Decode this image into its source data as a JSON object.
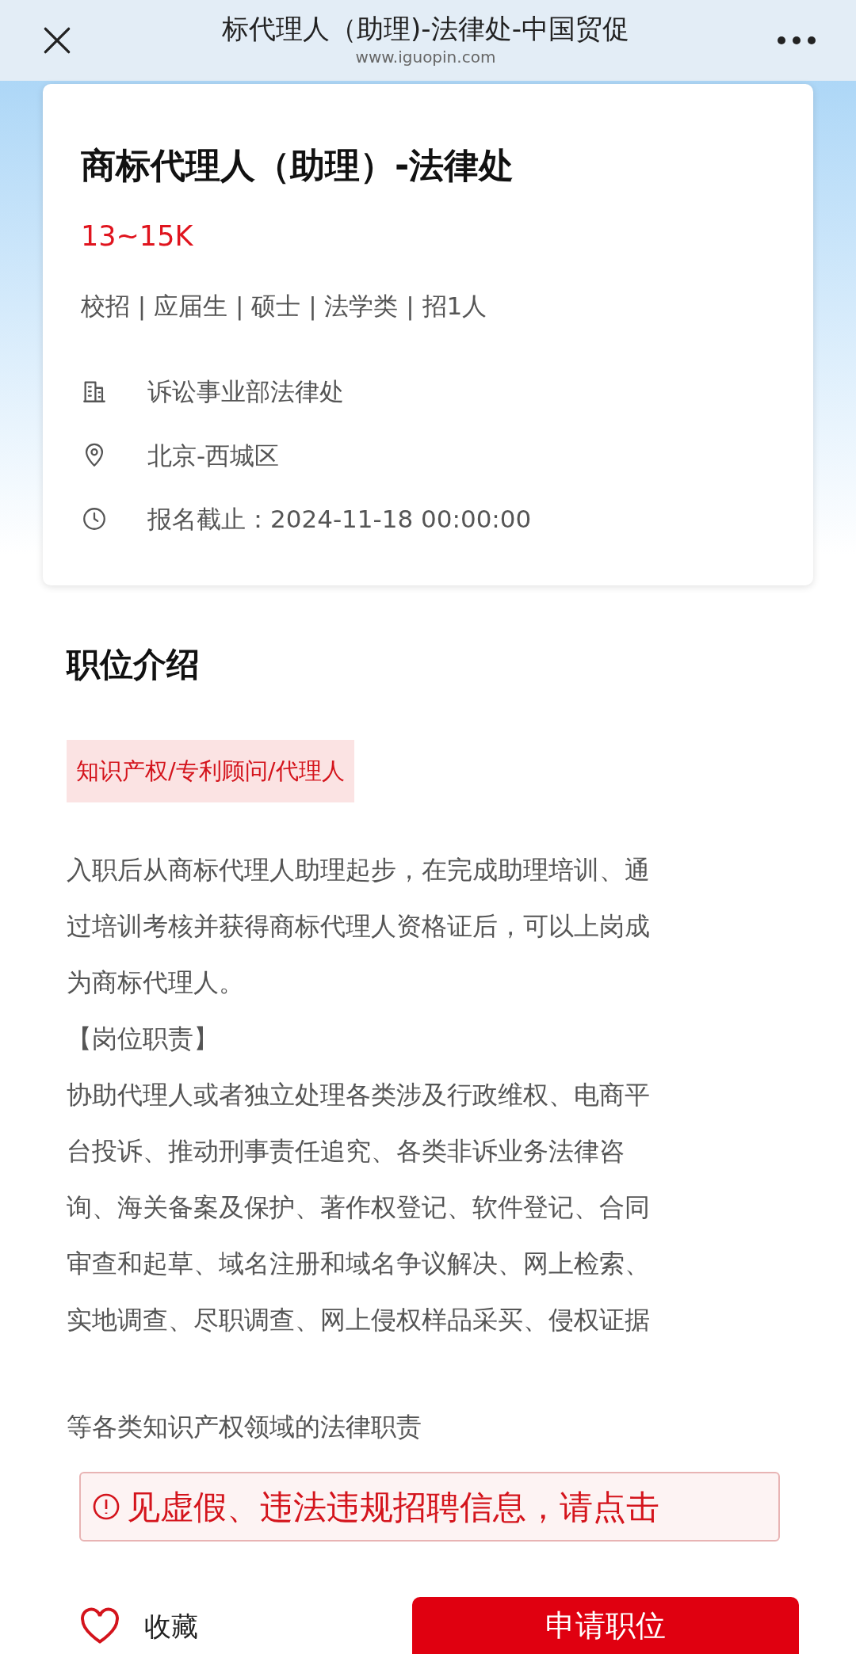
{
  "top_bar": {
    "title": "标代理人（助理)-法律处-中国贸促",
    "url": "www.iguopin.com"
  },
  "job": {
    "title": "商标代理人（助理）-法律处",
    "salary": "13~15K",
    "tags": "校招 | 应届生 | 硕士 | 法学类 | 招1人",
    "info": [
      {
        "kind": "building",
        "text": "诉讼事业部法律处"
      },
      {
        "kind": "location",
        "text": "北京-西城区"
      },
      {
        "kind": "clock",
        "text": "报名截止：2024-11-18 00:00:00"
      }
    ]
  },
  "intro": {
    "heading": "职位介绍",
    "category": "知识产权/专利顾问/代理人",
    "lines": [
      "入职后从商标代理人助理起步，在完成助理培训、通",
      "过培训考核并获得商标代理人资格证后，可以上岗成",
      "为商标代理人。",
      "【岗位职责】",
      "协助代理人或者独立处理各类涉及行政维权、电商平",
      "台投诉、推动刑事责任追究、各类非诉业务法律咨",
      "询、海关备案及保护、著作权登记、软件登记、合同",
      "审查和起草、域名注册和域名争议解决、网上检索、",
      "实地调查、尽职调查、网上侵权样品采买、侵权证据"
    ],
    "last_line": "等各类知识产权领域的法律职责"
  },
  "report_banner": "见虚假、违法违规招聘信息，请点击",
  "bottom_bar": {
    "favorite": "收藏",
    "apply": "申请职位"
  }
}
